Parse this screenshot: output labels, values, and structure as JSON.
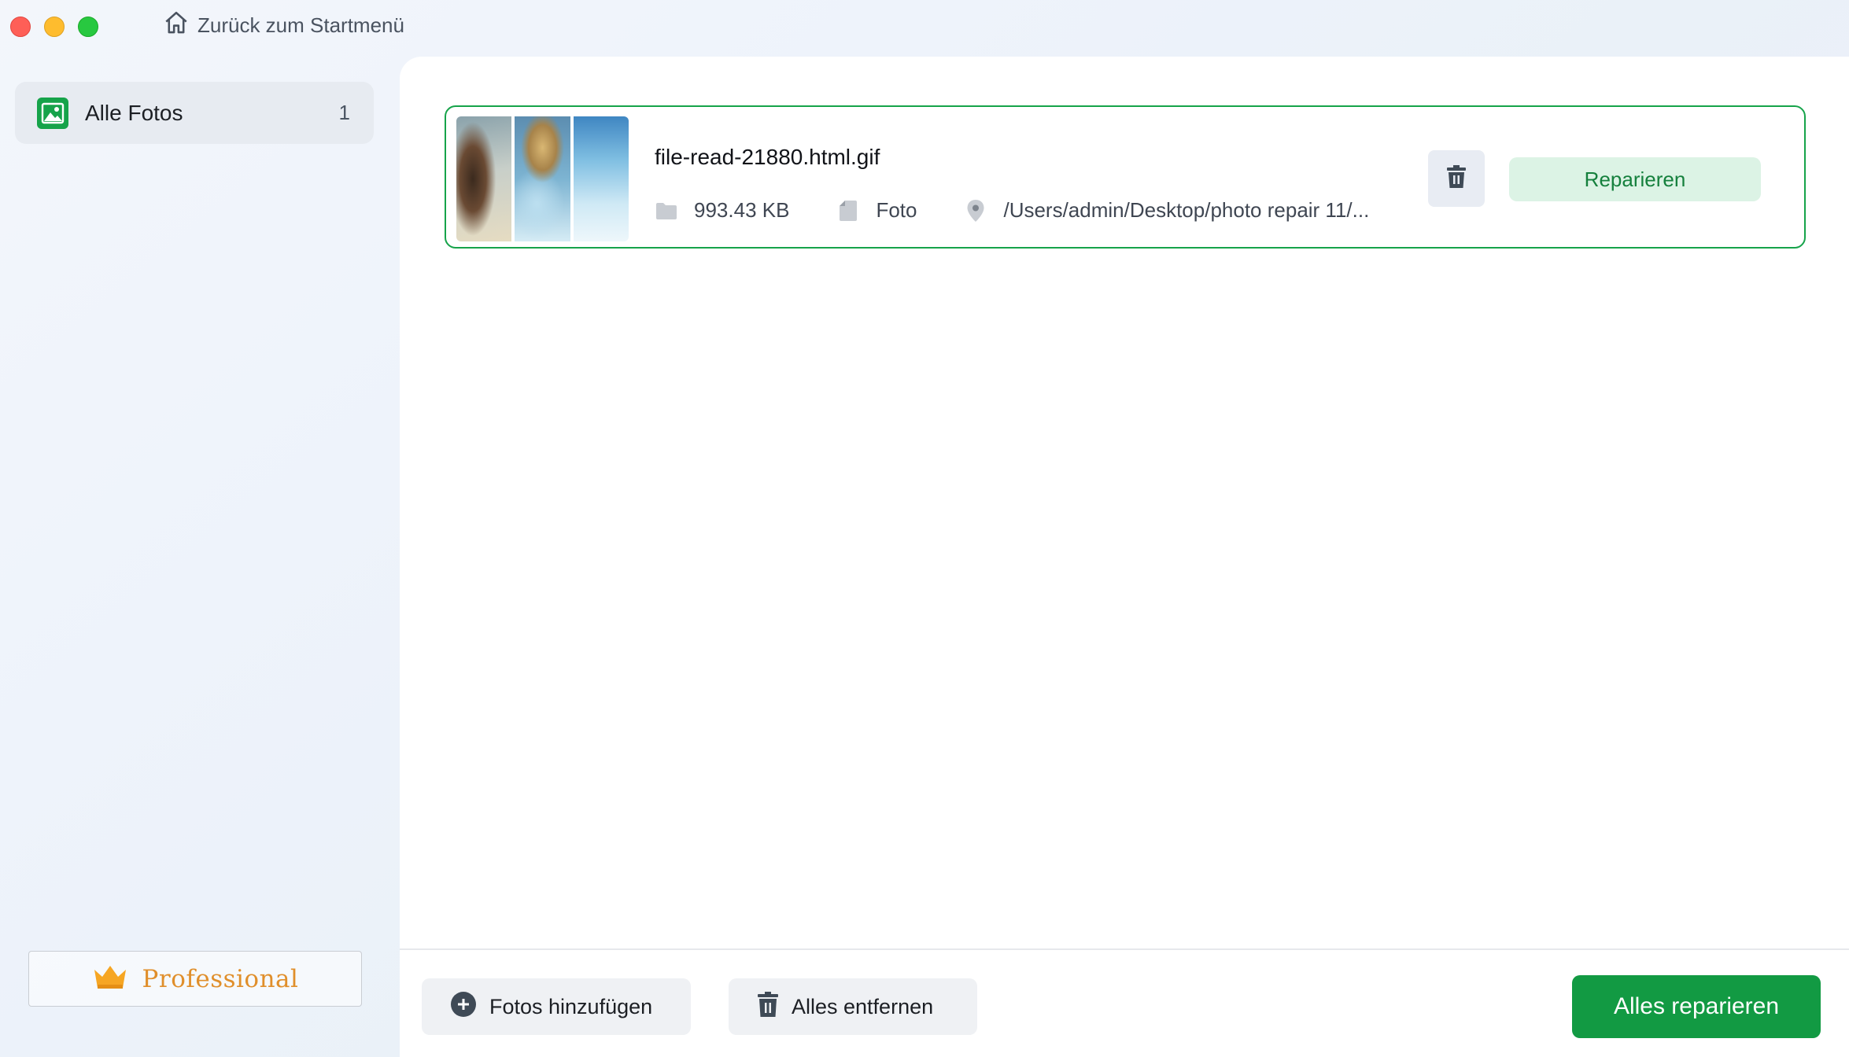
{
  "window": {
    "controls": [
      "close",
      "minimize",
      "maximize"
    ]
  },
  "header": {
    "back_label": "Zurück zum Startmenü",
    "back_icon": "home-icon"
  },
  "sidebar": {
    "items": [
      {
        "label": "Alle Fotos",
        "count": "1",
        "icon": "photo-icon"
      }
    ],
    "upgrade_label": "Professional",
    "upgrade_icon": "crown-icon"
  },
  "files": [
    {
      "name": "file-read-21880.html.gif",
      "size": "993.43 KB",
      "type": "Foto",
      "path": "/Users/admin/Desktop/photo repair 11/...",
      "repair_label": "Reparieren",
      "delete_icon": "trash-icon"
    }
  ],
  "footer": {
    "add_label": "Fotos hinzufügen",
    "remove_label": "Alles entfernen",
    "repair_all_label": "Alles reparieren"
  },
  "colors": {
    "accent": "#16a34a",
    "accent_light": "#dcf3e5",
    "primary_button": "#129a43",
    "upgrade": "#e08f2b"
  }
}
